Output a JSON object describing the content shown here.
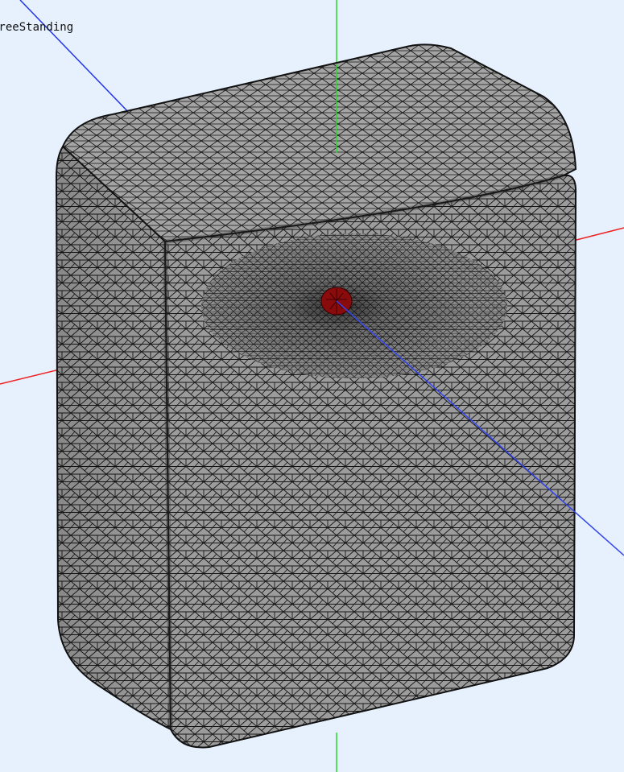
{
  "viewer": {
    "model_label": "FreeStanding",
    "background": "#e6f1fd",
    "axes": {
      "x_color": "#ee2222",
      "y_color": "#22dd22",
      "z_color": "#2233ee"
    },
    "mesh": {
      "surface_color": "#9c9c9c",
      "edge_color": "#111111",
      "highlight_color": "#8a0b0b"
    }
  }
}
